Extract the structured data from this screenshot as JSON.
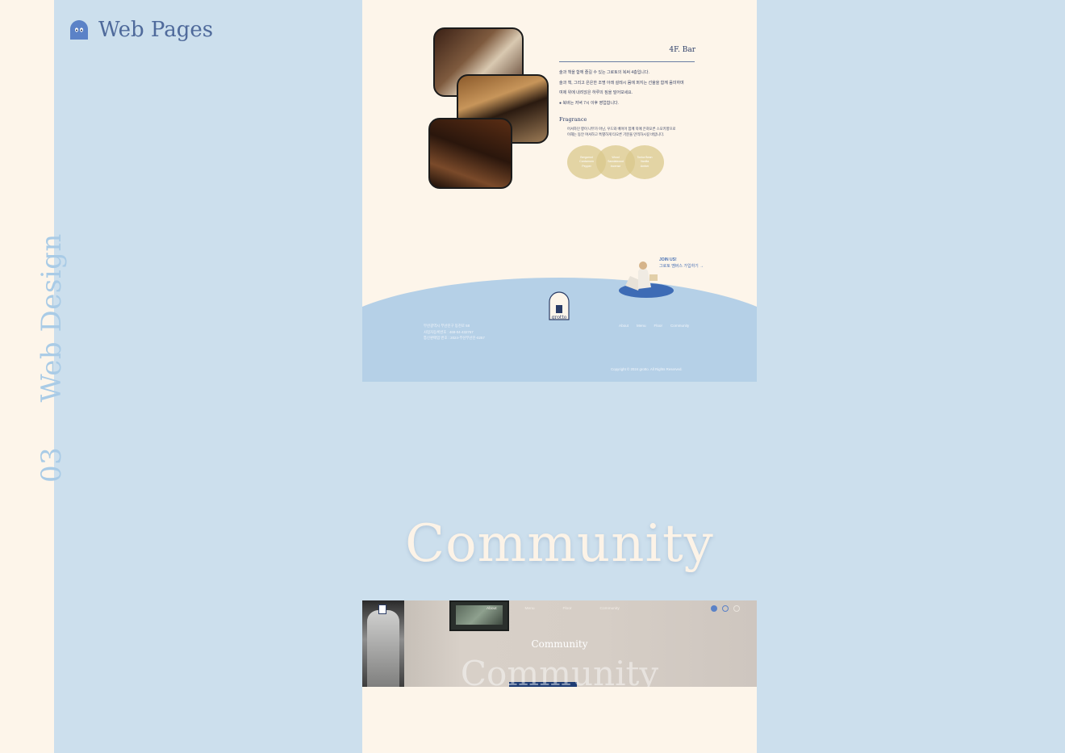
{
  "brand": {
    "title": "Web Pages",
    "icon": "ghost-logo-icon"
  },
  "side": {
    "number": "03",
    "label": "Web Design"
  },
  "floor": {
    "title": "4F. Bar",
    "lines": [
      "술과 책을 함께 즐길 수 있는 그로토의 복써 4층입니다.",
      "술과 책, 그리고 은은한 조명 아래 설레시 몸에 퍼지는 선율을 함께 음미하며",
      "여제 위에 내려앉은 하루의 짐을 덜어보세요.",
      "● 북바는 저녁 7시 이후 영업합니다."
    ],
    "fragrance_title": "Fragrance",
    "fragrance_lines": [
      "어셔하던 향이 나무가 아닌, 우드와 베이어 함께 북에 은혀오른 스모키향으로",
      "이해는 동안 여셔하고 특별하게 타오른 기분을 만끽하시길 바랍니다."
    ],
    "notes": [
      {
        "top": "Top Note",
        "name": "Bergamot\nCardamom\nPepper",
        "arc": "Top Scent"
      },
      {
        "top": "Heart",
        "name": "Wood\nSandalwood\nIncense",
        "arc": "Heart Scent"
      },
      {
        "top": "Base",
        "name": "Tonka Bean\nVanilla\nAmber",
        "arc": "Base Scent"
      }
    ]
  },
  "join": {
    "title": "JOIN US!",
    "link": "그로토 멤버스 가입하기 →"
  },
  "footer": {
    "logo_text": "grotto",
    "address": [
      "부산광역시 부산진구 동천로 58",
      "사업자등록번호 : 469-04-432767",
      "통신판매업 번호 : 2024-부산부산진-0257"
    ],
    "nav": [
      "About",
      "Menu",
      "Floor",
      "Community"
    ],
    "copyright": "Copyright © 2024 grotto. All Rights Reserved."
  },
  "community_heading": "Community",
  "page2": {
    "nav": [
      "About",
      "Menu",
      "Floor",
      "Community"
    ],
    "subtitle": "Community",
    "big_title": "Community",
    "icons": [
      "user-icon",
      "instagram-icon",
      "cart-icon"
    ]
  },
  "colors": {
    "background": "#ccdfed",
    "cream": "#fdf5ea",
    "navy": "#2b3c66",
    "accent_blue": "#4a72b5",
    "footer_blue": "#b5d0e7"
  }
}
